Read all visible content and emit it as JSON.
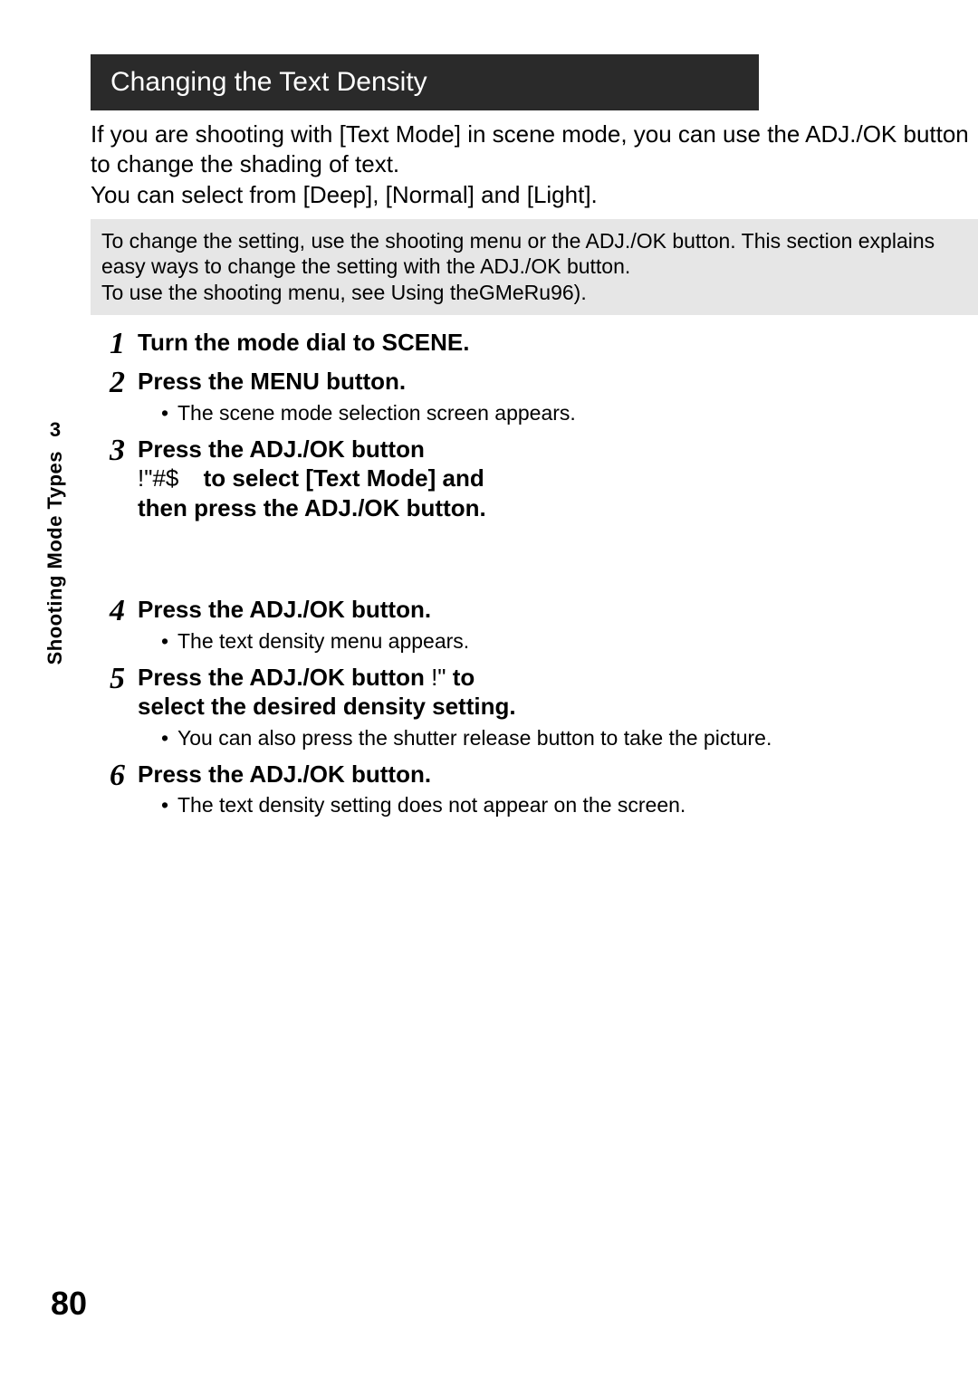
{
  "header": "Changing the Text Density",
  "intro": {
    "p1": "If you are shooting with [Text Mode] in scene mode, you can use the ADJ./OK button to change the shading of text.",
    "p2": "You can select from [Deep], [Normal] and [Light]."
  },
  "note": {
    "l1": "To change the setting, use the shooting menu or the ADJ./OK button. This section explains easy ways to change the setting with the ADJ./OK button.",
    "l2a": "To use the shooting menu, see  Using the",
    "l2b": "GMeRu96).",
    "l2mid": " "
  },
  "steps": {
    "s1": {
      "num": "1",
      "title": "Turn the mode dial to SCENE."
    },
    "s2": {
      "num": "2",
      "title": "Press the MENU button.",
      "b1": "The scene mode selection screen appears."
    },
    "s3": {
      "num": "3",
      "title_l1": "Press the ADJ./OK button",
      "sym": "!\"#$",
      "title_l2": "to select [Text Mode] and then press the ADJ./OK button."
    },
    "s4": {
      "num": "4",
      "title": "Press the ADJ./OK button.",
      "b1": "The text density menu appears."
    },
    "s5": {
      "num": "5",
      "title_a": "Press the ADJ./OK button ",
      "sym": "!\"",
      "title_b": " to select the desired density setting.",
      "b1": "You can also press the shutter release button to take the picture."
    },
    "s6": {
      "num": "6",
      "title": "Press the ADJ./OK button.",
      "b1": "The text density setting does not appear on the screen."
    }
  },
  "side": {
    "chapter": "3",
    "label": "Shooting Mode Types"
  },
  "page_number": "80"
}
